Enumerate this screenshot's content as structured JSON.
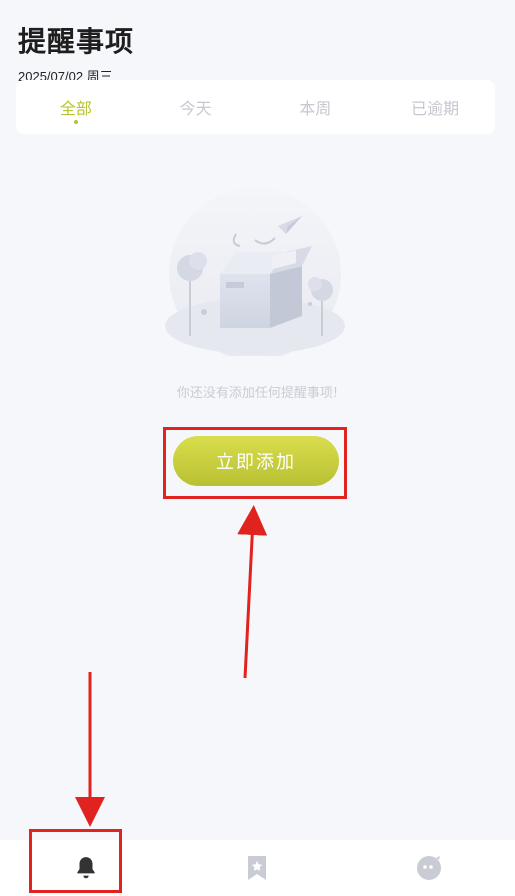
{
  "header": {
    "title": "提醒事项",
    "date": "2025/07/02 周三"
  },
  "tabs": [
    {
      "label": "全部",
      "active": true
    },
    {
      "label": "今天",
      "active": false
    },
    {
      "label": "本周",
      "active": false
    },
    {
      "label": "已逾期",
      "active": false
    }
  ],
  "empty_state": {
    "message": "你还没有添加任何提醒事项!",
    "add_button_label": "立即添加"
  },
  "bottom_nav": [
    {
      "icon": "bell-icon",
      "active": true
    },
    {
      "icon": "bookmark-star-icon",
      "active": false
    },
    {
      "icon": "profile-face-icon",
      "active": false
    }
  ],
  "colors": {
    "accent": "#b8c42f",
    "highlight_red": "#e0231e",
    "background": "#f6f7fb"
  }
}
